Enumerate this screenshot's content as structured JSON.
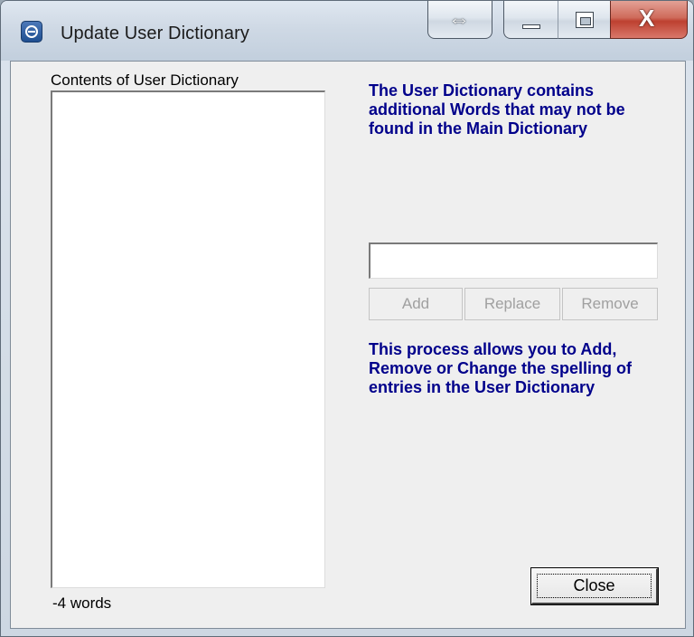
{
  "window": {
    "title": "Update User Dictionary",
    "controls": {
      "resize_glyph": "⇔",
      "close_glyph": "X"
    }
  },
  "list": {
    "label": "Contents of User Dictionary",
    "items": [],
    "word_count": "-4 words"
  },
  "info": {
    "top": "The User Dictionary contains additional Words that may not be found in the Main Dictionary",
    "bottom": "This process allows you to Add, Remove or Change the spelling of entries in the User Dictionary"
  },
  "editor": {
    "input_value": "",
    "add_label": "Add",
    "replace_label": "Replace",
    "remove_label": "Remove"
  },
  "footer": {
    "close_label": "Close"
  },
  "icons": {
    "app": "dictionary-app-icon",
    "resize": "resize-icon",
    "minimize": "minimize-icon",
    "maximize": "maximize-icon",
    "close": "close-icon"
  },
  "colors": {
    "info_text": "#00008b",
    "client_bg": "#efefef",
    "close_button_red": "#bd4030"
  }
}
